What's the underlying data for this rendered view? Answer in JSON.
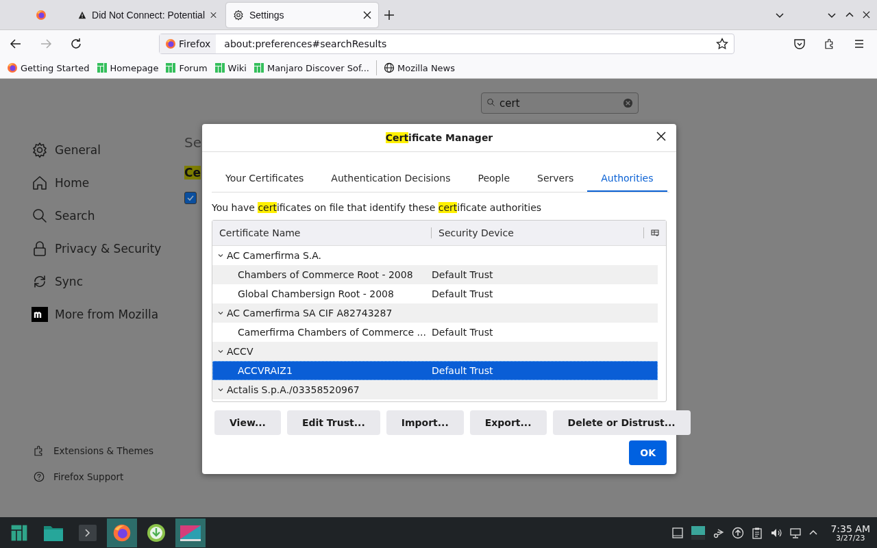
{
  "tabs": [
    {
      "kind": "pinned",
      "selected": false
    },
    {
      "kind": "warning",
      "label": "Did Not Connect: Potential",
      "selected": false
    },
    {
      "kind": "settings",
      "label": "Settings",
      "selected": true
    }
  ],
  "address": {
    "identity": "Firefox",
    "url": "about:preferences#searchResults"
  },
  "bookmarks": [
    {
      "kind": "firefox",
      "label": "Getting Started"
    },
    {
      "kind": "manjaro",
      "label": "Homepage"
    },
    {
      "kind": "manjaro",
      "label": "Forum"
    },
    {
      "kind": "manjaro",
      "label": "Wiki"
    },
    {
      "kind": "manjaro",
      "label": "Manjaro Discover Sof..."
    },
    {
      "kind": "globe",
      "label": "Mozilla News"
    }
  ],
  "search": {
    "value": "cert"
  },
  "sidebar": {
    "items": [
      {
        "kind": "gear",
        "label": "General"
      },
      {
        "kind": "home",
        "label": "Home"
      },
      {
        "kind": "search",
        "label": "Search"
      },
      {
        "kind": "lock",
        "label": "Privacy & Security"
      },
      {
        "kind": "sync",
        "label": "Sync"
      },
      {
        "kind": "mozilla",
        "label": "More from Mozilla"
      }
    ],
    "footer": [
      {
        "kind": "puzzle",
        "label": "Extensions & Themes"
      },
      {
        "kind": "help",
        "label": "Firefox Support"
      }
    ]
  },
  "page": {
    "heading": "Se",
    "section": "Ce",
    "checkbox_checked": true
  },
  "dialog": {
    "title": [
      {
        "text": "Cert",
        "highlight": true
      },
      {
        "text": "ificate Manager",
        "highlight": false
      }
    ],
    "tabs": [
      {
        "label": "Your Certificates",
        "selected": false
      },
      {
        "label": "Authentication Decisions",
        "selected": false
      },
      {
        "label": "People",
        "selected": false
      },
      {
        "label": "Servers",
        "selected": false
      },
      {
        "label": "Authorities",
        "selected": true
      }
    ],
    "description": [
      {
        "text": "You have ",
        "highlight": false
      },
      {
        "text": "cert",
        "highlight": true
      },
      {
        "text": "ificates on file that identify these ",
        "highlight": false
      },
      {
        "text": "cert",
        "highlight": true
      },
      {
        "text": "ificate authorities",
        "highlight": false
      }
    ],
    "columns": [
      "Certificate Name",
      "Security Device"
    ],
    "tree": [
      {
        "name": "AC Camerfirma S.A.",
        "expanded": true,
        "children": [
          {
            "name": "Chambers of Commerce Root - 2008",
            "device": "Default Trust",
            "selected": false
          },
          {
            "name": "Global Chambersign Root - 2008",
            "device": "Default Trust",
            "selected": false
          }
        ]
      },
      {
        "name": "AC Camerfirma SA CIF A82743287",
        "expanded": true,
        "children": [
          {
            "name": "Camerfirma Chambers of Commerce ...",
            "device": "Default Trust",
            "selected": false
          }
        ]
      },
      {
        "name": "ACCV",
        "expanded": true,
        "children": [
          {
            "name": "ACCVRAIZ1",
            "device": "Default Trust",
            "selected": true
          }
        ]
      },
      {
        "name": "Actalis S.p.A./03358520967",
        "expanded": true
      }
    ],
    "buttons": [
      "View...",
      "Edit Trust...",
      "Import...",
      "Export...",
      "Delete or Distrust..."
    ],
    "ok": "OK"
  },
  "clock": {
    "time": "7:35 AM",
    "date": "3/27/23"
  }
}
